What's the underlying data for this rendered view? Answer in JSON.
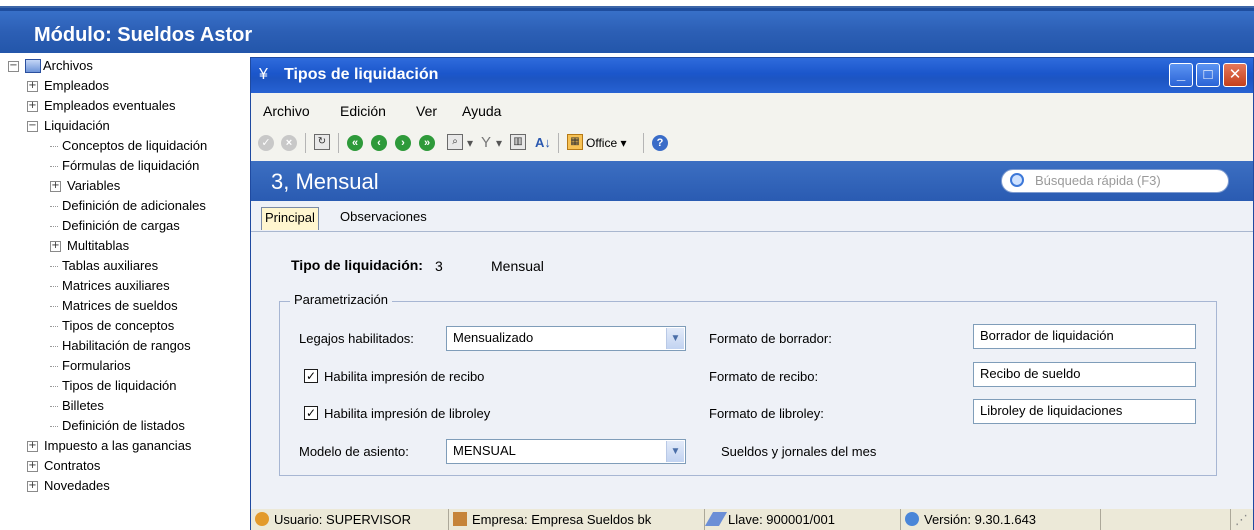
{
  "module": {
    "title": "Módulo: Sueldos Astor"
  },
  "tree": {
    "items": [
      {
        "label": "Archivos",
        "level": 0,
        "toggle": "minus",
        "icon": "folder-icon"
      },
      {
        "label": "Empleados",
        "level": 1,
        "toggle": "plus"
      },
      {
        "label": "Empleados eventuales",
        "level": 1,
        "toggle": "plus"
      },
      {
        "label": "Liquidación",
        "level": 1,
        "toggle": "minus"
      },
      {
        "label": "Conceptos de liquidación",
        "level": 2
      },
      {
        "label": "Fórmulas de liquidación",
        "level": 2
      },
      {
        "label": "Variables",
        "level": 2,
        "toggle": "plus"
      },
      {
        "label": "Definición de adicionales",
        "level": 2
      },
      {
        "label": "Definición de cargas",
        "level": 2
      },
      {
        "label": "Multitablas",
        "level": 2,
        "toggle": "plus"
      },
      {
        "label": "Tablas auxiliares",
        "level": 2
      },
      {
        "label": "Matrices auxiliares",
        "level": 2
      },
      {
        "label": "Matrices de sueldos",
        "level": 2
      },
      {
        "label": "Tipos de conceptos",
        "level": 2
      },
      {
        "label": "Habilitación de rangos",
        "level": 2
      },
      {
        "label": "Formularios",
        "level": 2
      },
      {
        "label": "Tipos de liquidación",
        "level": 2
      },
      {
        "label": "Billetes",
        "level": 2
      },
      {
        "label": "Definición de listados",
        "level": 2
      },
      {
        "label": "Impuesto a las ganancias",
        "level": 1,
        "toggle": "plus"
      },
      {
        "label": "Contratos",
        "level": 1,
        "toggle": "plus"
      },
      {
        "label": "Novedades",
        "level": 1,
        "toggle": "plus"
      }
    ]
  },
  "window": {
    "title": "Tipos de liquidación",
    "menu": [
      {
        "label": "Archivo"
      },
      {
        "label": "Edición"
      },
      {
        "label": "Ver"
      },
      {
        "label": "Ayuda"
      }
    ],
    "toolbar": {
      "office_label": "Office"
    },
    "record_title": "3, Mensual",
    "search_placeholder": "Búsqueda rápida (F3)",
    "tabs": [
      {
        "label": "Principal",
        "active": true
      },
      {
        "label": "Observaciones",
        "active": false
      }
    ],
    "form": {
      "tipo_label": "Tipo de liquidación:",
      "tipo_code": "3",
      "tipo_name": "Mensual",
      "group_label": "Parametrización",
      "legajos_label": "Legajos habilitados:",
      "legajos_value": "Mensualizado",
      "recibo_check_label": "Habilita impresión de recibo",
      "recibo_checked": true,
      "libroley_check_label": "Habilita impresión de libroley",
      "libroley_checked": true,
      "modelo_label": "Modelo de asiento:",
      "modelo_value": "MENSUAL",
      "modelo_desc": "Sueldos y jornales del mes",
      "borrador_label": "Formato de borrador:",
      "borrador_value": "Borrador de liquidación",
      "recibo_format_label": "Formato de recibo:",
      "recibo_format_value": "Recibo de sueldo",
      "libroley_format_label": "Formato de libroley:",
      "libroley_format_value": "Libroley de liquidaciones"
    },
    "status": {
      "usuario": "Usuario: SUPERVISOR",
      "empresa": "Empresa: Empresa Sueldos bk",
      "llave": "Llave: 900001/001",
      "version": "Versión: 9.30.1.643"
    }
  },
  "colors": {
    "accent": "#2c5fb5",
    "title_bar": "#1b56cb",
    "tab_active": "#fff6cf"
  }
}
